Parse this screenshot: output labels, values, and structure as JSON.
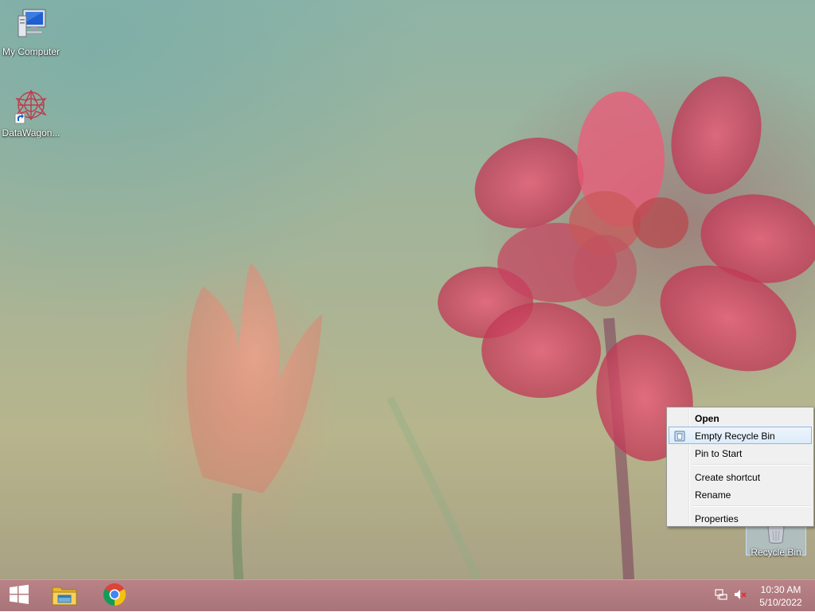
{
  "desktop": {
    "icons": [
      {
        "label": "My Computer",
        "icon": "computer-icon"
      },
      {
        "label": "DataWagon...",
        "icon": "datawagon-shortcut-icon"
      },
      {
        "label": "Recycle Bin",
        "icon": "recycle-bin-icon"
      }
    ]
  },
  "context_menu": {
    "items": [
      {
        "label": "Open",
        "bold": true
      },
      {
        "label": "Empty Recycle Bin",
        "highlighted": true,
        "icon": "recycle-bin-shield-icon"
      },
      {
        "label": "Pin to Start"
      },
      {
        "label": "Create shortcut"
      },
      {
        "label": "Rename"
      },
      {
        "label": "Properties"
      }
    ]
  },
  "taskbar": {
    "start_icon": "windows-logo-icon",
    "pinned": [
      {
        "name": "File Explorer",
        "icon": "file-explorer-icon"
      },
      {
        "name": "Google Chrome",
        "icon": "chrome-icon"
      }
    ],
    "tray": {
      "network_icon": "network-icon",
      "volume_icon": "volume-muted-icon",
      "time": "10:30 AM",
      "date": "5/10/2022"
    }
  },
  "colors": {
    "taskbar": "#a9747a",
    "menu_highlight": "#dcebfa",
    "menu_highlight_border": "#8fb8e0"
  }
}
